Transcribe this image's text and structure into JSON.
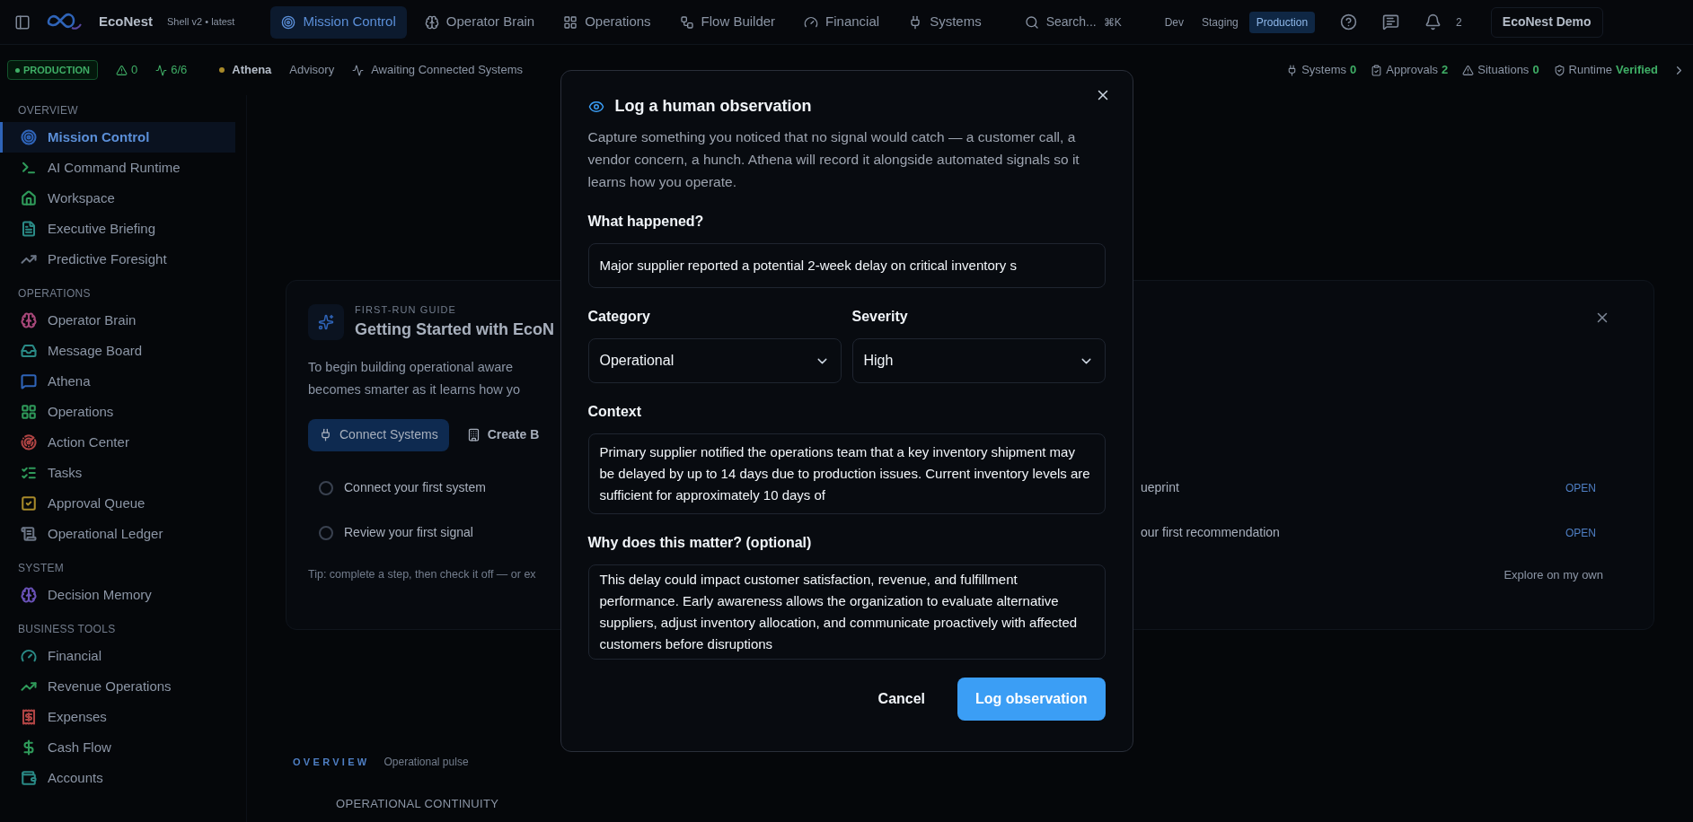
{
  "topbar": {
    "brand": "EcoNest",
    "version": "Shell v2 • latest",
    "nav": [
      {
        "label": "Mission Control",
        "selected": true
      },
      {
        "label": "Operator Brain",
        "selected": false
      },
      {
        "label": "Operations",
        "selected": false
      },
      {
        "label": "Flow Builder",
        "selected": false
      },
      {
        "label": "Financial",
        "selected": false
      },
      {
        "label": "Systems",
        "selected": false
      }
    ],
    "search": {
      "placeholder": "Search...",
      "shortcut": "⌘K"
    },
    "environments": [
      {
        "label": "Dev",
        "selected": false
      },
      {
        "label": "Staging",
        "selected": false
      },
      {
        "label": "Production",
        "selected": true
      }
    ],
    "notification_count": "2",
    "account": "EcoNest Demo"
  },
  "statusbar": {
    "environment": "PRODUCTION",
    "alerts": "0",
    "health": "6/6",
    "agent": "Athena",
    "mode": "Advisory",
    "status": "Awaiting Connected Systems",
    "stats": [
      {
        "label": "Systems",
        "value": "0"
      },
      {
        "label": "Approvals",
        "value": "2"
      },
      {
        "label": "Situations",
        "value": "0"
      },
      {
        "label": "Runtime",
        "value": "Verified"
      }
    ]
  },
  "sidebar": {
    "sections": [
      {
        "title": "OVERVIEW",
        "items": [
          {
            "label": "Mission Control",
            "selected": true,
            "color": "#2f64b8"
          },
          {
            "label": "AI Command Runtime",
            "selected": false,
            "color": "#2f9a5a"
          },
          {
            "label": "Workspace",
            "selected": false,
            "color": "#2f9a5a"
          },
          {
            "label": "Executive Briefing",
            "selected": false,
            "color": "#2a8a86"
          },
          {
            "label": "Predictive Foresight",
            "selected": false,
            "color": "#6b7585"
          }
        ]
      },
      {
        "title": "OPERATIONS",
        "items": [
          {
            "label": "Operator Brain",
            "selected": false,
            "color": "#a8487a"
          },
          {
            "label": "Message Board",
            "selected": false,
            "color": "#2a8a86"
          },
          {
            "label": "Athena",
            "selected": false,
            "color": "#2f64b8"
          },
          {
            "label": "Operations",
            "selected": false,
            "color": "#2f9a5a"
          },
          {
            "label": "Action Center",
            "selected": false,
            "color": "#b04444"
          },
          {
            "label": "Tasks",
            "selected": false,
            "color": "#2f9a5a"
          },
          {
            "label": "Approval Queue",
            "selected": false,
            "color": "#a88a2a"
          },
          {
            "label": "Operational Ledger",
            "selected": false,
            "color": "#6b7585"
          }
        ]
      },
      {
        "title": "SYSTEM",
        "items": [
          {
            "label": "Decision Memory",
            "selected": false,
            "color": "#6a52b8"
          }
        ]
      },
      {
        "title": "BUSINESS TOOLS",
        "items": [
          {
            "label": "Financial",
            "selected": false,
            "color": "#2a8a86"
          },
          {
            "label": "Revenue Operations",
            "selected": false,
            "color": "#2f9a5a"
          },
          {
            "label": "Expenses",
            "selected": false,
            "color": "#b04444"
          },
          {
            "label": "Cash Flow",
            "selected": false,
            "color": "#2f9a5a"
          },
          {
            "label": "Accounts",
            "selected": false,
            "color": "#2a8a86"
          }
        ]
      }
    ]
  },
  "guide": {
    "eyebrow": "FIRST-RUN GUIDE",
    "title": "Getting Started with EcoN",
    "description": [
      "To begin building operational aware",
      "becomes smarter as it learns how yo"
    ],
    "buttons": [
      "Connect Systems",
      "Create B"
    ],
    "rows": [
      {
        "left": "Connect your first system",
        "checked": false,
        "right": "ueprint",
        "action": "OPEN"
      },
      {
        "left": "Review your first signal",
        "checked": false,
        "right": "our first recommendation",
        "action": "OPEN"
      }
    ],
    "tip": "Tip: complete a step, then check it off — or ex",
    "dismiss": "Explore on my own"
  },
  "overview": {
    "label": "OVERVIEW",
    "subtitle": "Operational pulse",
    "section": "OPERATIONAL CONTINUITY"
  },
  "dialog": {
    "title": "Log a human observation",
    "description": "Capture something you noticed that no signal would catch — a customer call, a vendor concern, a hunch. Athena will record it alongside automated signals so it learns how you operate.",
    "what": {
      "label": "What happened?",
      "value": "Major supplier reported a potential 2-week delay on critical inventory s"
    },
    "category": {
      "label": "Category",
      "value": "Operational"
    },
    "severity": {
      "label": "Severity",
      "value": "High"
    },
    "context": {
      "label": "Context",
      "value": "Primary supplier notified the operations team that a key inventory shipment may be delayed by up to 14 days due to production issues. Current inventory levels are sufficient for approximately 10 days of"
    },
    "why": {
      "label": "Why does this matter? (optional)",
      "value": "This delay could impact customer satisfaction, revenue, and fulfillment performance. Early awareness allows the organization to evaluate alternative suppliers, adjust inventory allocation, and communicate proactively with affected customers before disruptions"
    },
    "buttons": {
      "cancel": "Cancel",
      "submit": "Log observation"
    }
  }
}
